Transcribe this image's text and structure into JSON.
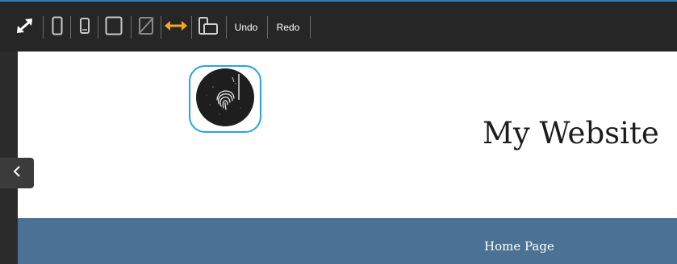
{
  "toolbar": {
    "tools": [
      {
        "icon": "fullscreen-icon"
      },
      {
        "icon": "phone-portrait-icon"
      },
      {
        "icon": "phone-small-icon"
      },
      {
        "icon": "tablet-icon"
      },
      {
        "icon": "no-tablet-icon"
      },
      {
        "icon": "fit-width-icon",
        "color": "#f5a623"
      },
      {
        "icon": "responsive-devices-icon"
      }
    ],
    "undo_label": "Undo",
    "redo_label": "Redo",
    "accent_color": "#2f7fc0"
  },
  "sidebar": {
    "collapse_icon": "chevron-left-icon"
  },
  "site": {
    "logo": "fingerprint-logo",
    "title": "My Website",
    "nav": {
      "items": [
        {
          "label": "Home Page"
        }
      ],
      "background": "#4b7294"
    },
    "selection_color": "#27a2e6"
  }
}
